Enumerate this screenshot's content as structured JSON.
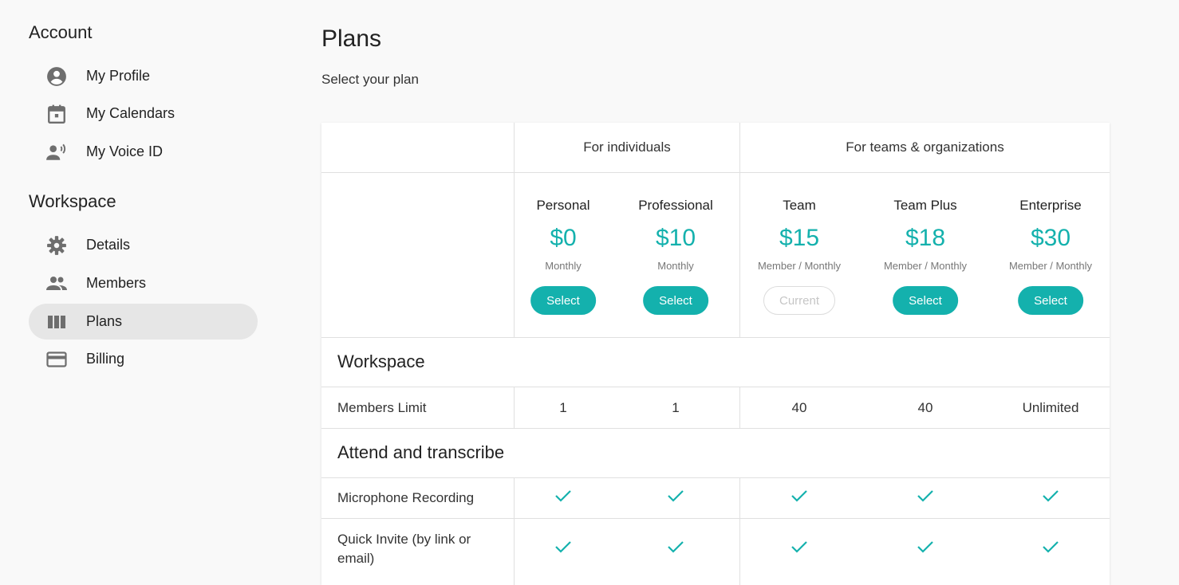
{
  "sidebar": {
    "account_title": "Account",
    "account_items": [
      {
        "label": "My Profile",
        "icon": "account-circle-icon"
      },
      {
        "label": "My Calendars",
        "icon": "calendar-icon"
      },
      {
        "label": "My Voice ID",
        "icon": "voice-id-icon"
      }
    ],
    "workspace_title": "Workspace",
    "workspace_items": [
      {
        "label": "Details",
        "icon": "gear-icon"
      },
      {
        "label": "Members",
        "icon": "people-icon"
      },
      {
        "label": "Plans",
        "icon": "columns-icon",
        "active": true
      },
      {
        "label": "Billing",
        "icon": "credit-card-icon"
      }
    ]
  },
  "main": {
    "title": "Plans",
    "subtitle": "Select your plan"
  },
  "table": {
    "groups": [
      "For individuals",
      "For teams & organizations"
    ],
    "plans": [
      {
        "name": "Personal",
        "price": "$0",
        "period": "Monthly",
        "button": "Select",
        "current": false
      },
      {
        "name": "Professional",
        "price": "$10",
        "period": "Monthly",
        "button": "Select",
        "current": false
      },
      {
        "name": "Team",
        "price": "$15",
        "period": "Member / Monthly",
        "button": "Current",
        "current": true
      },
      {
        "name": "Team Plus",
        "price": "$18",
        "period": "Member / Monthly",
        "button": "Select",
        "current": false
      },
      {
        "name": "Enterprise",
        "price": "$30",
        "period": "Member / Monthly",
        "button": "Select",
        "current": false
      }
    ],
    "sections": [
      {
        "title": "Workspace"
      },
      {
        "title": "Attend and transcribe"
      }
    ],
    "members_limit": {
      "label": "Members Limit",
      "values": [
        "1",
        "1",
        "40",
        "40",
        "Unlimited"
      ]
    },
    "microphone": {
      "label": "Microphone Recording"
    },
    "quick_invite": {
      "label": "Quick Invite (by link or email)"
    }
  },
  "colors": {
    "accent": "#14b1ad",
    "active_nav": "#e6e6e6",
    "icon_gray": "#6e6e6e"
  }
}
